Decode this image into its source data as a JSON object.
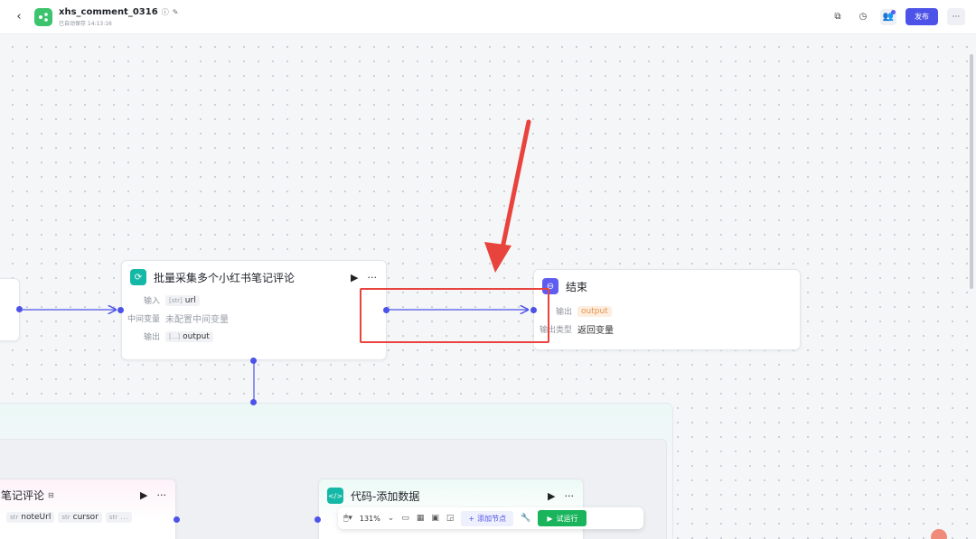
{
  "header": {
    "title": "xhs_comment_0316",
    "saved": "已自动保存 14:13:16",
    "publish_label": "发布"
  },
  "nodes": {
    "loop": {
      "title": "批量采集多个小红书笔记评论",
      "input_label": "输入",
      "input_value": "url",
      "input_type": "[str]",
      "mid_label": "中间变量",
      "mid_value": "未配置中间变量",
      "output_label": "输出",
      "output_value": "output",
      "output_type": "[...]"
    },
    "end": {
      "title": "结束",
      "output_label": "输出",
      "output_value": "output",
      "output_type_label": "输出类型",
      "output_type_value": "返回变量"
    },
    "comments": {
      "title": "笔记评论",
      "tags": [
        {
          "prefix": "str",
          "value": "noteUrl"
        },
        {
          "prefix": "str",
          "value": "cursor"
        },
        {
          "prefix": "str",
          "value": "..."
        }
      ]
    },
    "code": {
      "title": "代码-添加数据"
    }
  },
  "toolbar": {
    "zoom": "131%",
    "add_node_label": "添加节点",
    "run_label": "试运行"
  },
  "colors": {
    "accent": "#4d53e8",
    "run_green": "#19b45b",
    "annotation_red": "#e8433d",
    "loop_icon": "#14b8a6",
    "end_icon": "#5f5cf0"
  }
}
